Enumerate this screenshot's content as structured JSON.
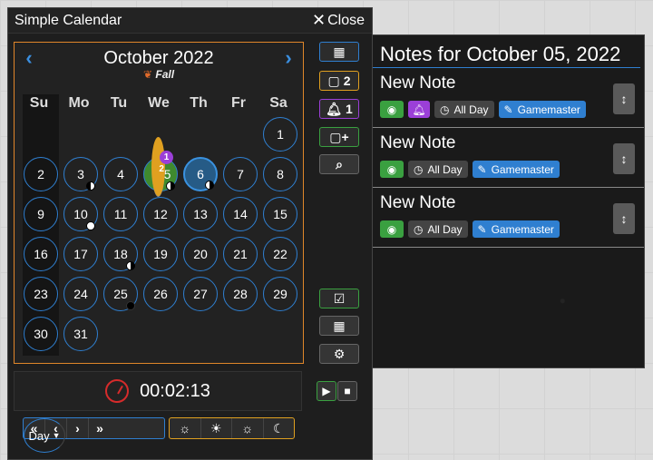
{
  "window": {
    "title": "Simple Calendar",
    "close_label": "Close"
  },
  "calendar": {
    "month_title": "October 2022",
    "season": "Fall",
    "weekdays": [
      "Su",
      "Mo",
      "Tu",
      "We",
      "Th",
      "Fr",
      "Sa"
    ],
    "days": [
      "1",
      "2",
      "3",
      "4",
      "5",
      "6",
      "7",
      "8",
      "9",
      "10",
      "11",
      "12",
      "13",
      "14",
      "15",
      "16",
      "17",
      "18",
      "19",
      "20",
      "21",
      "22",
      "23",
      "24",
      "25",
      "26",
      "27",
      "28",
      "29",
      "30",
      "31"
    ],
    "selected_day": "5",
    "today": "6",
    "note_badge_count": "2",
    "reminder_badge_count": "1",
    "colors": {
      "accent_blue": "#2f7fd0",
      "border_orange": "#e0862a",
      "selected_green": "#3f8a2e",
      "today_blue": "#265b86"
    }
  },
  "side_buttons": {
    "notes_count": "2",
    "reminders_count": "1",
    "icons": [
      "calendar-icon",
      "note-icon",
      "bell-icon",
      "add-note-icon",
      "search-icon",
      "calendar-check-icon",
      "calendar-icon",
      "gear-icon"
    ]
  },
  "timer": {
    "time": "00:02:13"
  },
  "navigation": {
    "unit_label": "Day"
  },
  "notes_panel": {
    "title": "Notes for October 05, 2022",
    "notes": [
      {
        "name": "New Note",
        "time_label": "All Day",
        "author": "Gamemaster",
        "has_reminder": true
      },
      {
        "name": "New Note",
        "time_label": "All Day",
        "author": "Gamemaster",
        "has_reminder": false
      },
      {
        "name": "New Note",
        "time_label": "All Day",
        "author": "Gamemaster",
        "has_reminder": false
      }
    ]
  }
}
